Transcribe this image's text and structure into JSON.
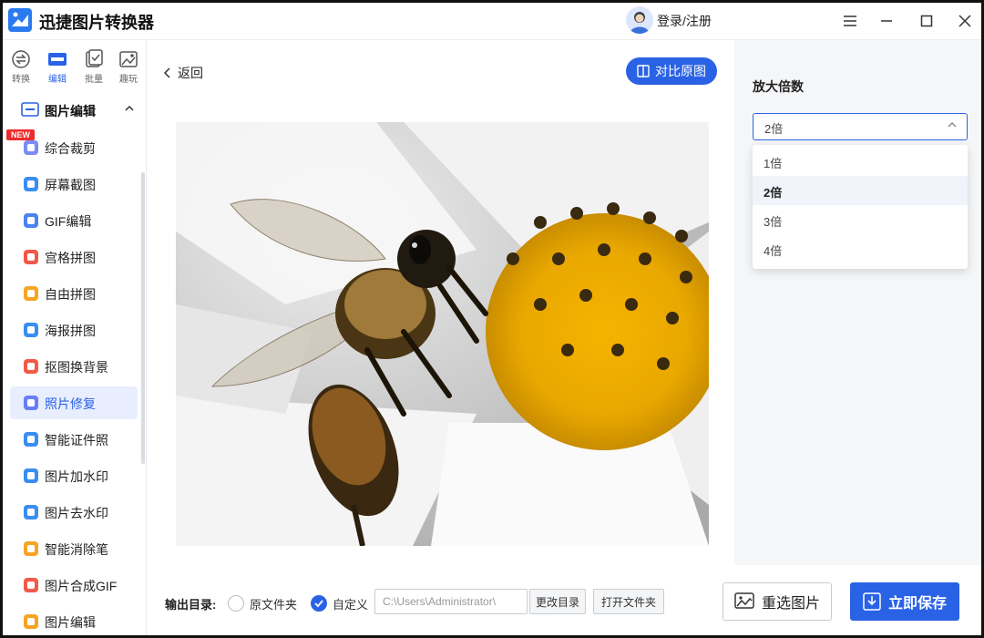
{
  "app": {
    "title": "迅捷图片转换器",
    "login": "登录/注册"
  },
  "top_tabs": [
    {
      "label": "转换",
      "icon": "convert-icon"
    },
    {
      "label": "编辑",
      "icon": "edit-icon",
      "active": true
    },
    {
      "label": "批量",
      "icon": "batch-icon"
    },
    {
      "label": "趣玩",
      "icon": "fun-icon"
    }
  ],
  "sidebar": {
    "section_title": "图片编辑",
    "new_badge": "NEW",
    "items": [
      {
        "label": "综合裁剪",
        "color": "#7c8cf5"
      },
      {
        "label": "屏幕截图",
        "color": "#3b8ef0"
      },
      {
        "label": "GIF编辑",
        "color": "#4a83f2"
      },
      {
        "label": "宫格拼图",
        "color": "#f0584a"
      },
      {
        "label": "自由拼图",
        "color": "#f5a524"
      },
      {
        "label": "海报拼图",
        "color": "#3b8ef0"
      },
      {
        "label": "抠图换背景",
        "color": "#f05a4a"
      },
      {
        "label": "照片修复",
        "color": "#6a7ef5",
        "active": true
      },
      {
        "label": "智能证件照",
        "color": "#3b8ef0"
      },
      {
        "label": "图片加水印",
        "color": "#3b8ef0"
      },
      {
        "label": "图片去水印",
        "color": "#3b8ef0"
      },
      {
        "label": "智能消除笔",
        "color": "#f5a524"
      },
      {
        "label": "图片合成GIF",
        "color": "#f05a4a"
      },
      {
        "label": "图片编辑",
        "color": "#f5a524"
      }
    ]
  },
  "main": {
    "back": "返回",
    "compare": "对比原图",
    "output_label": "输出目录:",
    "radio_original": "原文件夹",
    "radio_custom": "自定义",
    "path": "C:\\Users\\Administrator\\",
    "change_dir": "更改目录",
    "open_folder": "打开文件夹"
  },
  "panel": {
    "title": "放大倍数",
    "selected": "2倍",
    "options": [
      "1倍",
      "2倍",
      "3倍",
      "4倍"
    ],
    "reselect": "重选图片",
    "save": "立即保存"
  },
  "colors": {
    "accent": "#2a62e6",
    "accent_light": "#e8eefd",
    "badge": "#ee2b2b"
  }
}
